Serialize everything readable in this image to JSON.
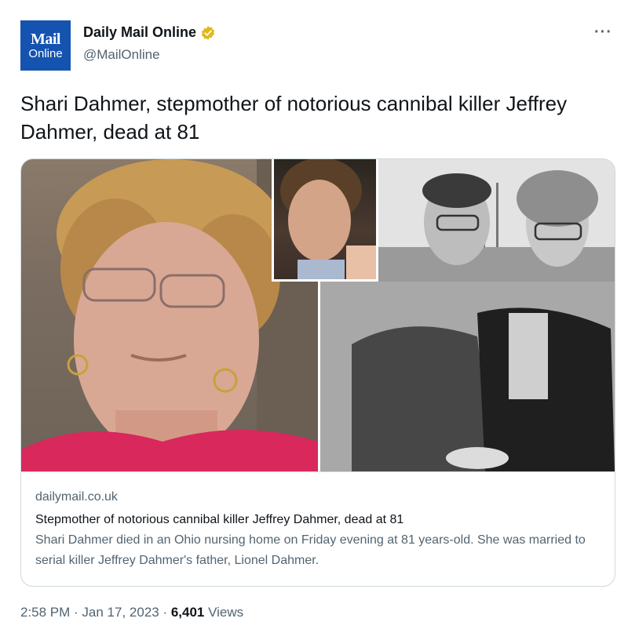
{
  "account": {
    "avatar_line1": "Mail",
    "avatar_line2": "Online",
    "name": "Daily Mail Online",
    "handle": "@MailOnline",
    "verified_icon": "verified-badge-gold"
  },
  "more_icon": "more-options-icon",
  "tweet": {
    "text": "Shari Dahmer, stepmother of notorious cannibal killer Jeffrey Dahmer, dead at 81"
  },
  "card": {
    "domain": "dailymail.co.uk",
    "title": "Stepmother of notorious cannibal killer Jeffrey Dahmer, dead at 81",
    "description": "Shari Dahmer died in an Ohio nursing home on Friday evening at 81 years-old. She was married to serial killer Jeffrey Dahmer's father, Lionel Dahmer."
  },
  "meta": {
    "time": "2:58 PM",
    "sep1": " · ",
    "date": "Jan 17, 2023",
    "sep2": " · ",
    "views_count": "6,401",
    "views_label": " Views"
  },
  "colors": {
    "brand_blue": "#1553b0",
    "verified_gold": "#e2b719",
    "secondary_text": "#536471",
    "border": "#cfd9de"
  }
}
